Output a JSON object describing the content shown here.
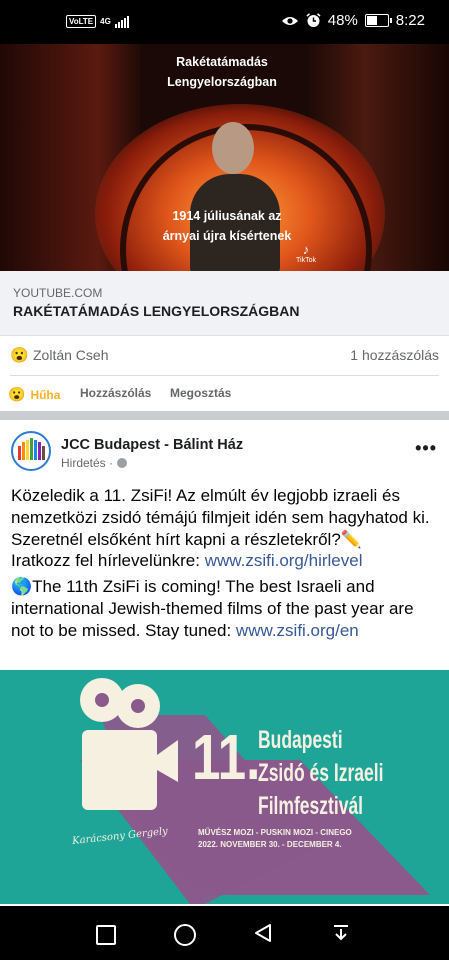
{
  "status_bar": {
    "network_badge": "VoLTE",
    "network_type": "4G",
    "battery": "48%",
    "time": "8:22",
    "icons": [
      "eye-icon",
      "alarm-icon",
      "battery-charging-icon",
      "signal-icon"
    ]
  },
  "video": {
    "title_line1": "Rakétatámadás",
    "title_line2": "Lengyelországban",
    "caption_line1": "1914 júliusának az",
    "caption_line2": "árnyai újra kísértenek",
    "watermark": "TikTok"
  },
  "link_preview": {
    "domain": "YOUTUBE.COM",
    "title": "RAKÉTATÁMADÁS LENGYELORSZÁGBAN"
  },
  "reactions": {
    "emoji": "😮",
    "user": "Zoltán Cseh",
    "comment_count": "1 hozzászólás"
  },
  "actions": {
    "wow": "Hűha",
    "comment": "Hozzászólás",
    "share": "Megosztás"
  },
  "post": {
    "page_name": "JCC Budapest - Bálint Ház",
    "sponsored": "Hirdetés ·",
    "para1": "Közeledik a 11. ZsiFi! Az elmúlt év legjobb izraeli és nemzetközi zsidó témájú filmjeit idén sem hagyhatod ki.",
    "para2": "Szeretnél elsőként hírt kapni a részletekről?✏️",
    "para3_prefix": "Iratkozz fel hírlevelünkre: ",
    "para3_link": "www.zsifi.org/hirlevel",
    "para4_prefix": "🌎The 11th ZsiFi is coming! The best Israeli and international Jewish-themed films of the past year are not to be missed. Stay tuned: ",
    "para4_link": "www.zsifi.org/en"
  },
  "banner": {
    "number": "11.",
    "title_line1": "Budapesti",
    "title_line2": "Zsidó és Izraeli",
    "title_line3": "Filmfesztivál",
    "venues": "MŰVÉSZ MOZI - PUSKIN MOZI - CINEGO",
    "dates": "2022. NOVEMBER 30. - DECEMBER 4.",
    "signature": "Karácsony Gergely",
    "colors": {
      "background": "#1ea598",
      "shape": "#8a5a8c",
      "text": "#f5f0e0"
    }
  },
  "nav_bar": {
    "buttons": [
      "recent-apps",
      "home",
      "back",
      "notifications-down"
    ]
  }
}
